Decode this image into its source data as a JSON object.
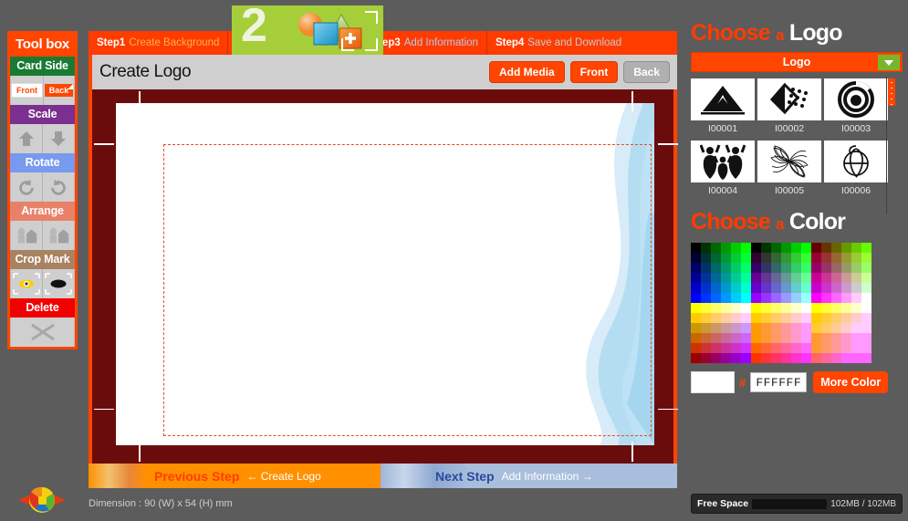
{
  "toolbox": {
    "title": "Tool box",
    "sections": [
      {
        "head": "Card Side",
        "color": "green",
        "icons": [
          "front-button",
          "back-button"
        ]
      },
      {
        "head": "Scale",
        "color": "purple",
        "icons": [
          "scale-up-icon",
          "scale-down-icon"
        ]
      },
      {
        "head": "Rotate",
        "color": "blue",
        "icons": [
          "rotate-left-icon",
          "rotate-right-icon"
        ]
      },
      {
        "head": "Arrange",
        "color": "salmon",
        "icons": [
          "bring-forward-icon",
          "send-backward-icon"
        ]
      },
      {
        "head": "Crop Mark",
        "color": "brown",
        "icons": [
          "crop-mark-show-icon",
          "crop-mark-hide-icon"
        ]
      },
      {
        "head": "Delete",
        "color": "red",
        "icons": [
          "delete-x-icon"
        ]
      }
    ],
    "front_label": "Front",
    "back_label": "Back"
  },
  "steps": [
    {
      "num": "Step1",
      "desc": "Create Background"
    },
    {
      "num": "Step3",
      "desc": "Add Information"
    },
    {
      "num": "Step4",
      "desc": "Save and Download"
    }
  ],
  "step2": {
    "number": "2"
  },
  "editor": {
    "title": "Create Logo",
    "buttons": [
      {
        "label": "Add Media",
        "state": "active"
      },
      {
        "label": "Front",
        "state": "active"
      },
      {
        "label": "Back",
        "state": "inactive"
      }
    ]
  },
  "bottom_nav": {
    "prev_label": "Previous Step",
    "prev_sub": "← Create Logo",
    "next_label": "Next Step",
    "next_sub": "Add Information →"
  },
  "dimension": "Dimension : 90 (W) x 54 (H) mm",
  "logo_panel": {
    "title_1": "Choose",
    "title_a": "a",
    "title_2": "Logo",
    "dropdown_label": "Logo",
    "items": [
      {
        "id": "I00001",
        "icon": "tent-logo-icon"
      },
      {
        "id": "I00002",
        "icon": "arrow-dots-logo-icon"
      },
      {
        "id": "I00003",
        "icon": "spiral-logo-icon"
      },
      {
        "id": "I00004",
        "icon": "people-logo-icon"
      },
      {
        "id": "I00005",
        "icon": "pinwheel-logo-icon"
      },
      {
        "id": "I00006",
        "icon": "globe-sketch-logo-icon"
      }
    ]
  },
  "color_panel": {
    "title_1": "Choose",
    "title_a": "a",
    "title_2": "Color",
    "hash": "#",
    "hex_value": "FFFFFF",
    "preview_color": "#FFFFFF",
    "more_color_label": "More Color"
  },
  "free_space": {
    "label": "Free Space",
    "value": "102MB / 102MB",
    "percent": 100
  },
  "theme": {
    "accent": "#FF4500",
    "step_bar": "#FF3C00",
    "step2_green": "#A6CE39",
    "canvas_frame": "#6B0C0C",
    "panel_bg": "#5C5C5C"
  }
}
